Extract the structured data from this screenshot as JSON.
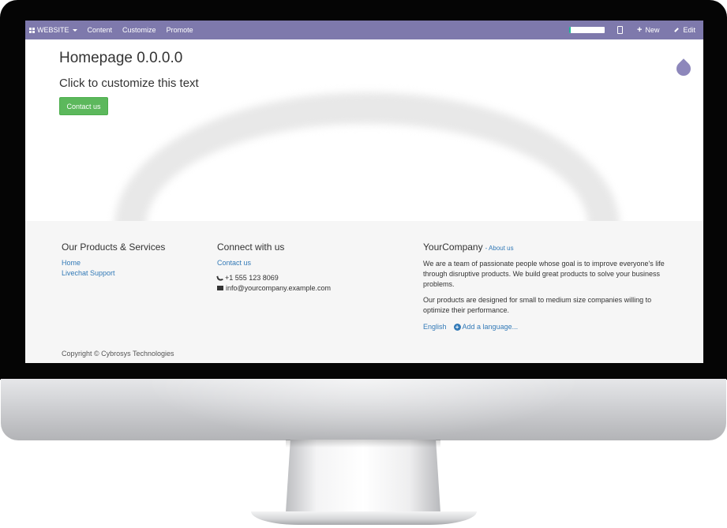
{
  "topbar": {
    "website_label": "WEBSITE",
    "nav": [
      "Content",
      "Customize",
      "Promote"
    ],
    "progress_fraction": 0.05,
    "new_label": "New",
    "edit_label": "Edit",
    "bg_color": "#7e79ac"
  },
  "hero": {
    "title": "Homepage 0.0.0.0",
    "subtitle": "Click to customize this text",
    "contact_button": "Contact us"
  },
  "footer": {
    "products": {
      "heading": "Our Products & Services",
      "links": [
        "Home",
        "Livechat Support"
      ]
    },
    "connect": {
      "heading": "Connect with us",
      "contact_link": "Contact us",
      "phone": "+1 555 123 8069",
      "email": "info@yourcompany.example.com"
    },
    "company": {
      "name": "YourCompany",
      "about_link": "- About us",
      "paragraph1": "We are a team of passionate people whose goal is to improve everyone's life through disruptive products. We build great products to solve your business problems.",
      "paragraph2": "Our products are designed for small to medium size companies willing to optimize their performance.",
      "language": "English",
      "add_language": "Add a language..."
    },
    "copyright": "Copyright © Cybrosys Technologies"
  },
  "colors": {
    "accent": "#7e79ac",
    "button_green": "#5cb85c",
    "link_blue": "#337ab7"
  }
}
